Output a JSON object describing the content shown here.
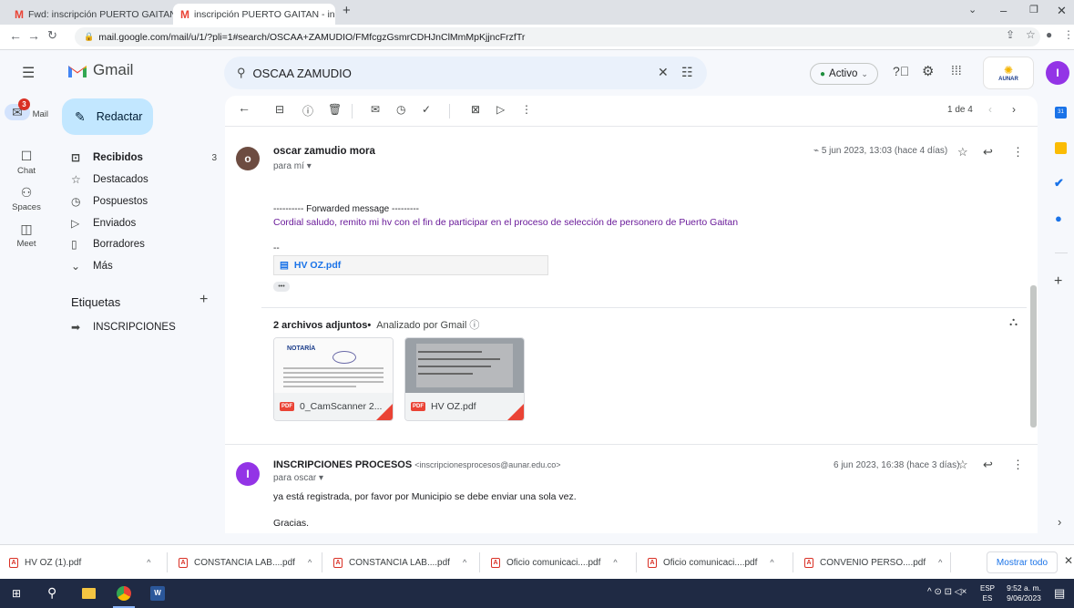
{
  "browser": {
    "tabs": [
      {
        "label": "Fwd: inscripción PUERTO GAITAN",
        "active": false
      },
      {
        "label": "inscripción PUERTO GAITAN - ins",
        "active": true
      }
    ],
    "new_tab": "+",
    "url": "mail.google.com/mail/u/1/?pli=1#search/OSCAA+ZAMUDIO/FMfcgzGsmrCDHJnClMmMpKjjncFrzfTr"
  },
  "gmail": {
    "logo_text": "Gmail",
    "search_value": "OSCAA ZAMUDIO",
    "status_label": "Activo",
    "org_label": "AUNAR",
    "account_initial": "I",
    "compose_label": "Redactar",
    "rail": [
      {
        "label": "Mail",
        "icon": "mail-icon",
        "badge": "3"
      },
      {
        "label": "Chat",
        "icon": "chat-icon"
      },
      {
        "label": "Spaces",
        "icon": "spaces-icon"
      },
      {
        "label": "Meet",
        "icon": "meet-icon"
      }
    ],
    "nav": [
      {
        "label": "Recibidos",
        "count": "3",
        "icon": "inbox-icon",
        "bold": true
      },
      {
        "label": "Destacados",
        "count": "",
        "icon": "star-icon"
      },
      {
        "label": "Pospuestos",
        "count": "",
        "icon": "clock-icon"
      },
      {
        "label": "Enviados",
        "count": "",
        "icon": "send-icon"
      },
      {
        "label": "Borradores",
        "count": "",
        "icon": "draft-icon"
      },
      {
        "label": "Más",
        "count": "",
        "icon": "chevron-down-icon"
      }
    ],
    "labels_title": "Etiquetas",
    "labels": [
      {
        "label": "INSCRIPCIONES",
        "icon": "label-icon"
      }
    ],
    "pager": "1 de 4"
  },
  "messages": [
    {
      "avatar": "o",
      "avatar_color": "#6d4c41",
      "sender": "oscar zamudio mora",
      "to": "para mí",
      "date": "5 jun 2023, 13:03 (hace 4 días)",
      "forwarded": "---------- Forwarded message ---------",
      "body": "Cordial saludo, remito mi hv con el fin de participar en el proceso de selección de personero de Puerto Gaitan",
      "sig": "--",
      "inline_file": "HV OZ.pdf",
      "ellipsis": "•••",
      "attachments_title": "2 archivos adjuntos",
      "attachments_note": "Analizado por Gmail",
      "attachments": [
        {
          "name": "0_CamScanner 2...",
          "thumb_title": "NOTARÍA"
        },
        {
          "name": "HV OZ.pdf",
          "thumb_title": ""
        }
      ]
    },
    {
      "avatar": "I",
      "avatar_color": "#9334e6",
      "sender": "INSCRIPCIONES PROCESOS",
      "email": "<inscripcionesprocesos@aunar.edu.co>",
      "to": "para oscar",
      "date": "6 jun 2023, 16:38 (hace 3 días)",
      "body": "ya está registrada, por favor por Municipio se debe enviar una sola vez.",
      "closing": "Gracias."
    }
  ],
  "downloads": {
    "items": [
      "HV OZ (1).pdf",
      "CONSTANCIA LAB....pdf",
      "CONSTANCIA LAB....pdf",
      "Oficio comunicaci....pdf",
      "Oficio comunicaci....pdf",
      "CONVENIO PERSO....pdf"
    ],
    "show_all": "Mostrar todo"
  },
  "taskbar": {
    "lang": "ESP",
    "lang2": "ES",
    "time": "9:52 a. m.",
    "date": "9/06/2023"
  }
}
